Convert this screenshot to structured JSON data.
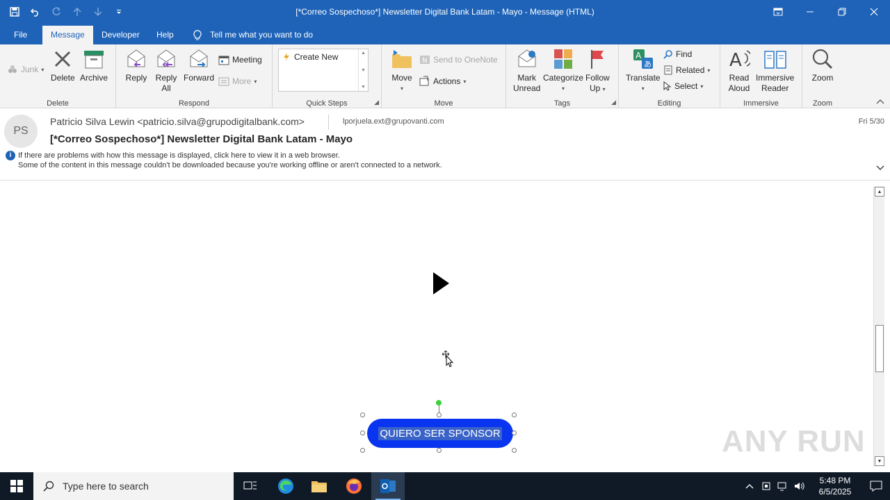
{
  "window": {
    "title": "[*Correo Sospechoso*] Newsletter Digital Bank Latam - Mayo  -  Message (HTML)"
  },
  "tabs": [
    {
      "label": "File",
      "active": false
    },
    {
      "label": "Message",
      "active": true
    },
    {
      "label": "Developer",
      "active": false
    },
    {
      "label": "Help",
      "active": false
    }
  ],
  "tell_me": "Tell me what you want to do",
  "ribbon": {
    "delete_group": {
      "label": "Delete",
      "junk": "Junk",
      "delete": "Delete",
      "archive": "Archive"
    },
    "respond_group": {
      "label": "Respond",
      "reply": "Reply",
      "reply_all_1": "Reply",
      "reply_all_2": "All",
      "forward": "Forward",
      "meeting": "Meeting",
      "more": "More"
    },
    "quicksteps_group": {
      "label": "Quick Steps",
      "create_new": "Create New"
    },
    "move_group": {
      "label": "Move",
      "move": "Move",
      "onenote": "Send to OneNote",
      "actions": "Actions"
    },
    "tags_group": {
      "label": "Tags",
      "mark_unread_1": "Mark",
      "mark_unread_2": "Unread",
      "categorize": "Categorize",
      "follow_up_1": "Follow",
      "follow_up_2": "Up"
    },
    "editing_group": {
      "label": "Editing",
      "translate": "Translate",
      "find": "Find",
      "related": "Related",
      "select": "Select"
    },
    "immersive_group": {
      "label": "Immersive",
      "read_aloud_1": "Read",
      "read_aloud_2": "Aloud",
      "immersive_reader_1": "Immersive",
      "immersive_reader_2": "Reader"
    },
    "zoom_group": {
      "label": "Zoom",
      "zoom": "Zoom"
    }
  },
  "message": {
    "avatar_initials": "PS",
    "from": "Patricio Silva Lewin <patricio.silva@grupodigitalbank.com>",
    "to": "lporjuela.ext@grupovanti.com",
    "date": "Fri 5/30",
    "subject": "[*Correo Sospechoso*] Newsletter Digital Bank Latam - Mayo",
    "info_line_1": "If there are problems with how this message is displayed, click here to view it in a web browser.",
    "info_line_2": "Some of the content in this message couldn't be downloaded because you're working offline or aren't connected to a network."
  },
  "body": {
    "sponsor_button": "QUIERO SER SPONSOR",
    "watermark": "ANY RUN"
  },
  "taskbar": {
    "search_placeholder": "Type here to search",
    "time": "5:48 PM",
    "date": "6/5/2025"
  },
  "colors": {
    "accent": "#1e63b8",
    "sponsor_button": "#0a35f0"
  }
}
